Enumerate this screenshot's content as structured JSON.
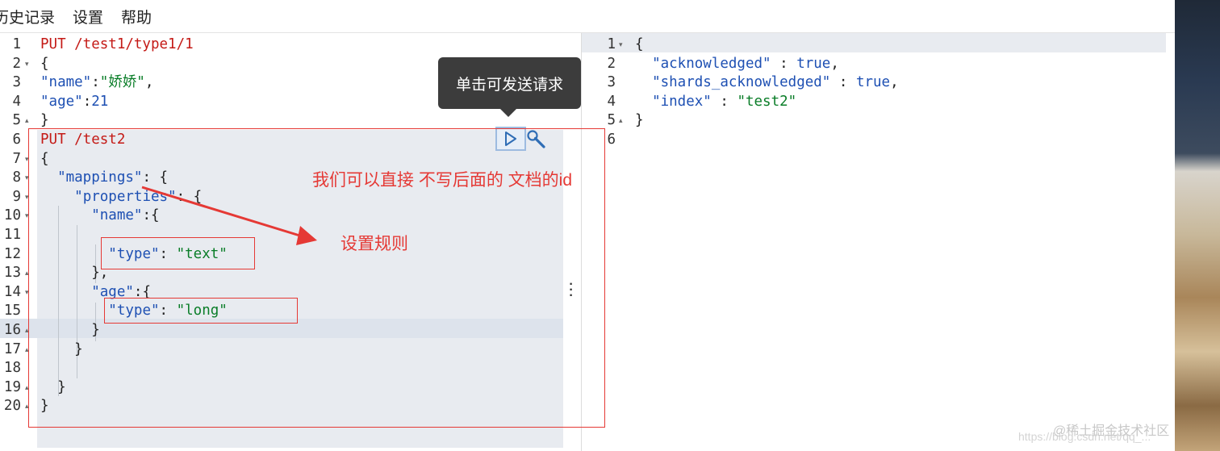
{
  "menu": {
    "history": "历史记录",
    "settings": "设置",
    "help": "帮助"
  },
  "request_lines": [
    {
      "no": "1",
      "fold": "",
      "segments": [
        {
          "c": "m",
          "t": "PUT /test1/type1/1"
        }
      ]
    },
    {
      "no": "2",
      "fold": "▾",
      "segments": [
        {
          "c": "p",
          "t": "{"
        }
      ]
    },
    {
      "no": "3",
      "fold": "",
      "segments": [
        {
          "c": "k",
          "t": "\"name\""
        },
        {
          "c": "p",
          "t": ":"
        },
        {
          "c": "s",
          "t": "\"娇娇\""
        },
        {
          "c": "p",
          "t": ","
        }
      ]
    },
    {
      "no": "4",
      "fold": "",
      "segments": [
        {
          "c": "k",
          "t": "\"age\""
        },
        {
          "c": "p",
          "t": ":"
        },
        {
          "c": "n",
          "t": "21"
        }
      ]
    },
    {
      "no": "5",
      "fold": "▴",
      "segments": [
        {
          "c": "p",
          "t": "}"
        }
      ]
    },
    {
      "no": "6",
      "fold": "",
      "segments": [
        {
          "c": "m",
          "t": "PUT /test2"
        }
      ]
    },
    {
      "no": "7",
      "fold": "▾",
      "segments": [
        {
          "c": "p",
          "t": "{"
        }
      ]
    },
    {
      "no": "8",
      "fold": "▾",
      "segments": [
        {
          "c": "p",
          "t": "  "
        },
        {
          "c": "k",
          "t": "\"mappings\""
        },
        {
          "c": "p",
          "t": ": {"
        }
      ]
    },
    {
      "no": "9",
      "fold": "▾",
      "segments": [
        {
          "c": "p",
          "t": "    "
        },
        {
          "c": "k",
          "t": "\"properties\""
        },
        {
          "c": "p",
          "t": ": {"
        }
      ]
    },
    {
      "no": "10",
      "fold": "▾",
      "segments": [
        {
          "c": "p",
          "t": "      "
        },
        {
          "c": "k",
          "t": "\"name\""
        },
        {
          "c": "p",
          "t": ":{"
        }
      ]
    },
    {
      "no": "11",
      "fold": "",
      "segments": []
    },
    {
      "no": "12",
      "fold": "",
      "segments": [
        {
          "c": "p",
          "t": "        "
        },
        {
          "c": "k",
          "t": "\"type\""
        },
        {
          "c": "p",
          "t": ": "
        },
        {
          "c": "s",
          "t": "\"text\""
        }
      ]
    },
    {
      "no": "13",
      "fold": "▴",
      "segments": [
        {
          "c": "p",
          "t": "      },"
        }
      ]
    },
    {
      "no": "14",
      "fold": "▾",
      "segments": [
        {
          "c": "p",
          "t": "      "
        },
        {
          "c": "k",
          "t": "\"age\""
        },
        {
          "c": "p",
          "t": ":{"
        }
      ]
    },
    {
      "no": "15",
      "fold": "",
      "segments": [
        {
          "c": "p",
          "t": "        "
        },
        {
          "c": "k",
          "t": "\"type\""
        },
        {
          "c": "p",
          "t": ": "
        },
        {
          "c": "s",
          "t": "\"long\""
        }
      ]
    },
    {
      "no": "16",
      "fold": "▴",
      "segments": [
        {
          "c": "p",
          "t": "      }"
        }
      ]
    },
    {
      "no": "17",
      "fold": "▴",
      "segments": [
        {
          "c": "p",
          "t": "    }"
        }
      ]
    },
    {
      "no": "18",
      "fold": "",
      "segments": []
    },
    {
      "no": "19",
      "fold": "▴",
      "segments": [
        {
          "c": "p",
          "t": "  }"
        }
      ]
    },
    {
      "no": "20",
      "fold": "▴",
      "segments": [
        {
          "c": "p",
          "t": "}"
        }
      ]
    }
  ],
  "response_lines": [
    {
      "no": "1",
      "fold": "▾",
      "segments": [
        {
          "c": "p",
          "t": "{"
        }
      ]
    },
    {
      "no": "2",
      "fold": "",
      "segments": [
        {
          "c": "p",
          "t": "  "
        },
        {
          "c": "k",
          "t": "\"acknowledged\""
        },
        {
          "c": "p",
          "t": " : "
        },
        {
          "c": "n",
          "t": "true"
        },
        {
          "c": "p",
          "t": ","
        }
      ]
    },
    {
      "no": "3",
      "fold": "",
      "segments": [
        {
          "c": "p",
          "t": "  "
        },
        {
          "c": "k",
          "t": "\"shards_acknowledged\""
        },
        {
          "c": "p",
          "t": " : "
        },
        {
          "c": "n",
          "t": "true"
        },
        {
          "c": "p",
          "t": ","
        }
      ]
    },
    {
      "no": "4",
      "fold": "",
      "segments": [
        {
          "c": "p",
          "t": "  "
        },
        {
          "c": "k",
          "t": "\"index\""
        },
        {
          "c": "p",
          "t": " : "
        },
        {
          "c": "s",
          "t": "\"test2\""
        }
      ]
    },
    {
      "no": "5",
      "fold": "▴",
      "segments": [
        {
          "c": "p",
          "t": "}"
        }
      ]
    },
    {
      "no": "6",
      "fold": "",
      "segments": []
    }
  ],
  "tooltip": {
    "text": "单击可发送请求"
  },
  "annotations": {
    "note_no_id": "我们可以直接 不写后面的 文档的id",
    "note_rules": "设置规则"
  },
  "watermark": {
    "brand": "@稀土掘金技术社区",
    "url": "https://blog.csdn.net/qq_..."
  },
  "icons": {
    "run": "play-icon",
    "tools": "wrench-icon",
    "more": "more-vertical-icon"
  },
  "colors": {
    "method": "#c41a16",
    "key": "#1e50b3",
    "string": "#0a7d28",
    "annotation": "#e53935"
  }
}
